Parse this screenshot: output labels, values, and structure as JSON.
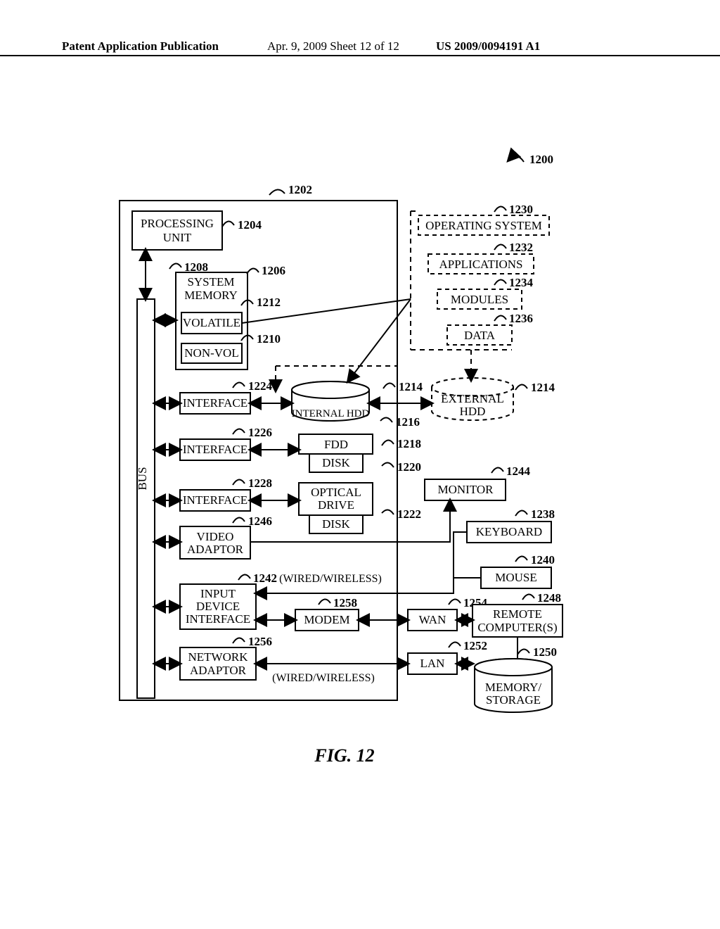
{
  "header": {
    "left": "Patent Application Publication",
    "mid": "Apr. 9, 2009  Sheet 12 of 12",
    "right": "US 2009/0094191 A1"
  },
  "figure_label": "FIG. 12",
  "refs": {
    "r1200": "1200",
    "r1202": "1202",
    "r1204": "1204",
    "r1206": "1206",
    "r1208": "1208",
    "r1210": "1210",
    "r1212": "1212",
    "r1214a": "1214",
    "r1214b": "1214",
    "r1216": "1216",
    "r1218": "1218",
    "r1220": "1220",
    "r1222": "1222",
    "r1224": "1224",
    "r1226": "1226",
    "r1228": "1228",
    "r1230": "1230",
    "r1232": "1232",
    "r1234": "1234",
    "r1236": "1236",
    "r1238": "1238",
    "r1240": "1240",
    "r1242": "1242",
    "r1244": "1244",
    "r1246": "1246",
    "r1248": "1248",
    "r1250": "1250",
    "r1252": "1252",
    "r1254": "1254",
    "r1256": "1256",
    "r1258": "1258"
  },
  "boxes": {
    "processing_unit_1": "PROCESSING",
    "processing_unit_2": "UNIT",
    "system_memory_1": "SYSTEM",
    "system_memory_2": "MEMORY",
    "volatile": "VOLATILE",
    "nonvol": "NON-VOL",
    "interface1": "INTERFACE",
    "interface2": "INTERFACE",
    "interface3": "INTERFACE",
    "video_adaptor_1": "VIDEO",
    "video_adaptor_2": "ADAPTOR",
    "input_dev_1": "INPUT",
    "input_dev_2": "DEVICE",
    "input_dev_3": "INTERFACE",
    "net_adapt_1": "NETWORK",
    "net_adapt_2": "ADAPTOR",
    "bus": "BUS",
    "internal_hdd": "INTERNAL HDD",
    "external_hdd_1": "EXTERNAL",
    "external_hdd_2": "HDD",
    "fdd": "FDD",
    "disk1": "DISK",
    "optical_1": "OPTICAL",
    "optical_2": "DRIVE",
    "disk2": "DISK",
    "os": "OPERATING SYSTEM",
    "apps": "APPLICATIONS",
    "modules": "MODULES",
    "data": "DATA",
    "monitor": "MONITOR",
    "keyboard": "KEYBOARD",
    "mouse": "MOUSE",
    "remote_1": "REMOTE",
    "remote_2": "COMPUTER(S)",
    "modem": "MODEM",
    "wan": "WAN",
    "lan": "LAN",
    "memstore_1": "MEMORY/",
    "memstore_2": "STORAGE",
    "wired_wireless": "(WIRED/WIRELESS)",
    "wired_wireless2": "(WIRED/WIRELESS)"
  }
}
